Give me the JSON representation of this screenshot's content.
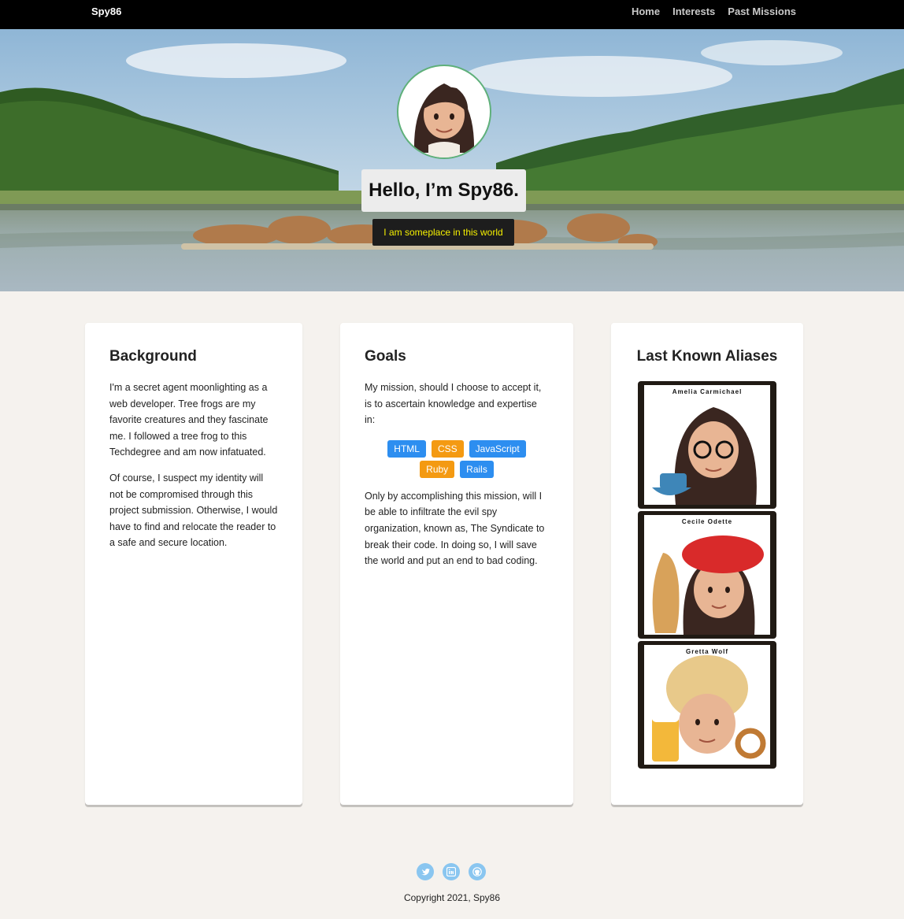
{
  "nav": {
    "brand": "Spy86",
    "links": [
      "Home",
      "Interests",
      "Past Missions"
    ]
  },
  "hero": {
    "title": "Hello, I’m Spy86.",
    "subtitle": "I am someplace in this world"
  },
  "background": {
    "heading": "Background",
    "paragraphs": [
      "I'm a secret agent moonlighting as a web developer. Tree frogs are my favorite creatures and they fascinate me. I followed a tree frog to this Techdegree and am now infatuated.",
      "Of course, I suspect my identity will not be compromised through this project submission. Otherwise, I would have to find and relocate the reader to a safe and secure location."
    ]
  },
  "goals": {
    "heading": "Goals",
    "intro": "My mission, should I choose to accept it, is to ascertain knowledge and expertise in:",
    "tags": [
      {
        "label": "HTML",
        "color": "#2d8ef0"
      },
      {
        "label": "CSS",
        "color": "#f49a12"
      },
      {
        "label": "JavaScript",
        "color": "#2d8ef0"
      },
      {
        "label": "Ruby",
        "color": "#f49a12"
      },
      {
        "label": "Rails",
        "color": "#2d8ef0"
      }
    ],
    "outro": "Only by accomplishing this mission, will I be able to infiltrate the evil spy organization, known as, The Syndicate to break their code. In doing so, I will save the world and put an end to bad coding."
  },
  "aliases": {
    "heading": "Last Known Aliases",
    "items": [
      {
        "name": "Amelia Carmichael"
      },
      {
        "name": "Cecile Odette"
      },
      {
        "name": "Gretta Wolf"
      }
    ]
  },
  "footer": {
    "social_icons": [
      "twitter-icon",
      "linkedin-icon",
      "github-icon"
    ],
    "copyright": "Copyright 2021, Spy86"
  }
}
